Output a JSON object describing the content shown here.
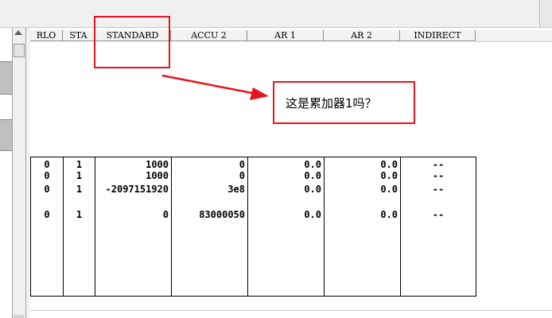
{
  "table": {
    "headers": [
      "RLO",
      "STA",
      "STANDARD",
      "ACCU 2",
      "AR 1",
      "AR 2",
      "INDIRECT"
    ],
    "rows": [
      {
        "rlo": "0",
        "sta": "1",
        "standard": "1000",
        "accu2": "0",
        "ar1": "0.0",
        "ar2": "0.0",
        "indirect": "--"
      },
      {
        "rlo": "0",
        "sta": "1",
        "standard": "1000",
        "accu2": "0",
        "ar1": "0.0",
        "ar2": "0.0",
        "indirect": "--"
      },
      {
        "rlo": "0",
        "sta": "1",
        "standard": "-2097151920",
        "accu2": "3e8",
        "ar1": "0.0",
        "ar2": "0.0",
        "indirect": "--"
      },
      {
        "rlo": "0",
        "sta": "1",
        "standard": "0",
        "accu2": "83000050",
        "ar1": "0.0",
        "ar2": "0.0",
        "indirect": "--"
      }
    ]
  },
  "annotation": {
    "question": "这是累加器1吗？",
    "color": "#e6141e"
  },
  "icons": {
    "scroll_up": "scroll-up-arrow-icon"
  }
}
